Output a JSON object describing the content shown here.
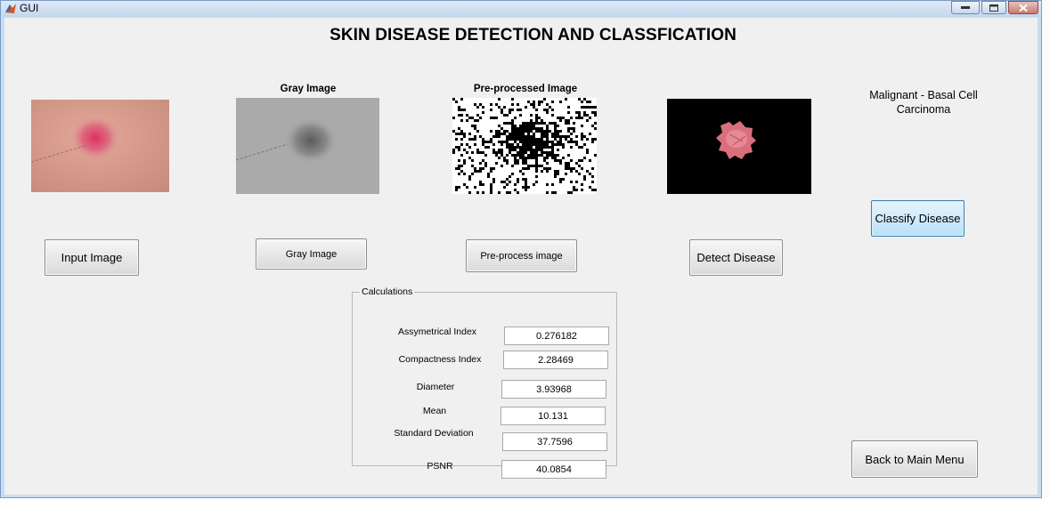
{
  "window": {
    "title": "GUI"
  },
  "page": {
    "title": "SKIN DISEASE DETECTION AND CLASSFICATION"
  },
  "images": {
    "gray_label": "Gray Image",
    "preprocessed_label": "Pre-processed Image"
  },
  "buttons": {
    "input_image": "Input Image",
    "gray_image": "Gray Image",
    "preprocess_image": "Pre-process image",
    "detect_disease": "Detect Disease",
    "classify_disease": "Classify Disease",
    "back_to_main_menu": "Back to Main Menu"
  },
  "result": {
    "line1": "Malignant - Basal Cell",
    "line2": "Carcinoma"
  },
  "calculations": {
    "title": "Calculations",
    "rows": [
      {
        "label": "Assymetrical Index",
        "value": "0.276182"
      },
      {
        "label": "Compactness Index",
        "value": "2.28469"
      },
      {
        "label": "Diameter",
        "value": "3.93968"
      },
      {
        "label": "Mean",
        "value": "10.131"
      },
      {
        "label": "Standard Deviation",
        "value": "37.7596"
      },
      {
        "label": "PSNR",
        "value": "40.0854"
      }
    ]
  },
  "colors": {
    "accent_button": "#b9e0fa",
    "window_frame": "#c7dcf2",
    "client_bg": "#f0f0f0"
  },
  "icons": [
    "matlab-icon",
    "minimize-icon",
    "maximize-icon",
    "close-icon"
  ]
}
